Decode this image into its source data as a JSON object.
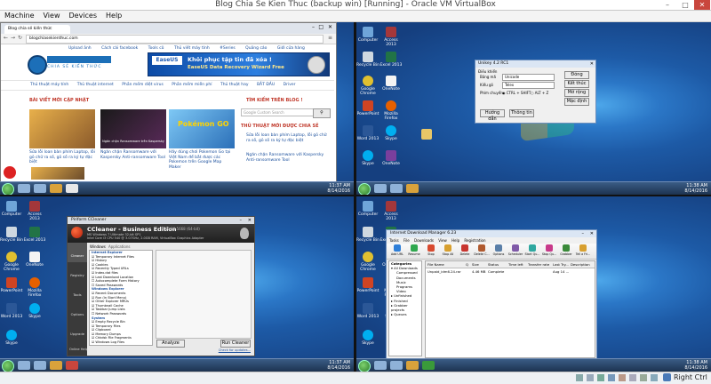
{
  "host": {
    "title": "Blog Chia Se Kien Thuc (backup win) [Running] - Oracle VM VirtualBox",
    "menu": [
      "Machine",
      "View",
      "Devices",
      "Help"
    ],
    "status_right": "Right Ctrl"
  },
  "desktop_icons": {
    "computer": "Computer",
    "access": "Access 2013",
    "recycle": "Recycle Bin",
    "excel": "Excel 2013",
    "chrome": "Google Chrome",
    "onenote": "OneNote",
    "skype": "Skype",
    "powerpoint": "PowerPoint",
    "firefox": "Mozilla Firefox",
    "word": "Word 2013"
  },
  "tray": {
    "q1": {
      "time": "11:37 AM",
      "date": "8/14/2016"
    },
    "q2": {
      "time": "11:38 AM",
      "date": "8/14/2016"
    },
    "q3": {
      "time": "11:37 AM",
      "date": "8/14/2016"
    },
    "q4": {
      "time": "11:38 AM",
      "date": "8/14/2016"
    }
  },
  "browser": {
    "tab": "Blog chia sẻ kiến thức",
    "url": "blogchiasekienthuc.com",
    "top_links": [
      "Upload ảnh",
      "Cách cài facebook",
      "Tools cũ",
      "Thủ viết máy tính",
      "#Series",
      "Quảng cáo",
      "Giới cửa hàng"
    ],
    "logo_text": "CHIA SẺ KIẾN THỨC",
    "ad_brand": "EaseUS",
    "ad_line1": "Khôi phục tập tin đã xóa !",
    "ad_line2": "EaseUS Data Recovery Wizard Free",
    "nav": [
      "Thủ thuật máy tính",
      "Thủ thuật internet",
      "Phần mềm diệt virus",
      "Phần mềm miễn phí",
      "Thủ thuật hay",
      "BẮT ĐẦU",
      "Driver"
    ],
    "section_new": "BÀI VIẾT MỚI CẬP NHẬT",
    "section_search": "TÌM KIẾM TRÊN BLOG !",
    "search_placeholder": "Google Custom Search",
    "section_share": "THỦ THUẬT MỚI ĐƯỢC CHIA SẺ",
    "thumb2_caption": "Ngăn chặn Ransomware trên Kaspersky",
    "thumb3_text": "Pokémon GO",
    "articles": [
      "Sửa lỗi loan bàn phím Laptop, lỗi gõ chữ ra số, gõ số ra ký tự đặc biệt",
      "Ngăn chặn Ransomware với Kaspersky Anti-ransomware Tool",
      "Hãy dùng chơi Pokemon Go tại Việt Nam để bắt được các Pokemon trên Google Map Maker"
    ],
    "share_items": [
      "Sửa lỗi loan bàn phím Laptop, lỗi gõ chữ ra số, gõ số ra ký tự đặc biệt",
      "Ngăn chặn Ransomware với Kaspersky Anti-ransomware Tool"
    ]
  },
  "unikey": {
    "title": "Unikey 4.2 RC1",
    "section_control": "Điều khiển",
    "labels": {
      "charset": "Bảng mã",
      "method": "Kiểu gõ",
      "switch": "Phím chuyển"
    },
    "charset": "Unicode",
    "method": "Telex",
    "radio1": "CTRL + SHIFT",
    "radio2": "ALT + Z",
    "buttons": {
      "close": "Đóng",
      "exit": "Kết thúc",
      "more": "Mở rộng",
      "default": "Mặc định",
      "help": "Hướng dẫn",
      "info": "Thông tin"
    }
  },
  "ccleaner": {
    "title": "Piriform CCleaner",
    "product": "CCleaner - Business Edition",
    "version": "v5.20.5668 (64-bit)",
    "sysinfo1": "MS Windows 7 Ultimate 32-bit SP1",
    "sysinfo2": "Intel Core i3 CPU 540 @ 3.07GHz, 2.0GB RAM, VirtualBox Graphics Adapter",
    "tabs": [
      "Windows",
      "Applications"
    ],
    "sidebar": [
      "Cleaner",
      "Registry",
      "Tools",
      "Options",
      "Upgrade"
    ],
    "groups": {
      "ie": "Internet Explorer",
      "explorer": "Windows Explorer",
      "system": "System"
    },
    "items_ie": [
      "Temporary Internet Files",
      "History",
      "Cookies",
      "Recently Typed URLs",
      "Index.dat files",
      "Last Download Location",
      "Autocomplete Form History",
      "Saved Passwords"
    ],
    "items_explorer": [
      "Recent Documents",
      "Run (in Start Menu)",
      "Other Explorer MRUs",
      "Thumbnail Cache",
      "Taskbar Jump Lists",
      "Network Passwords"
    ],
    "items_system": [
      "Empty Recycle Bin",
      "Temporary Files",
      "Clipboard",
      "Memory Dumps",
      "Chkdsk File Fragments",
      "Windows Log Files"
    ],
    "analyze": "Analyze",
    "run": "Run Cleaner",
    "online_help": "Online Help",
    "check_updates": "Check for updates..."
  },
  "idm": {
    "title": "Internet Download Manager 6.23",
    "menu": [
      "Tasks",
      "File",
      "Downloads",
      "View",
      "Help",
      "Registration"
    ],
    "toolbar": [
      "Add URL",
      "Resume",
      "Stop",
      "Stop All",
      "Delete",
      "Delete C...",
      "Options",
      "Scheduler",
      "Start Qu...",
      "Stop Qu...",
      "Grabber",
      "Tell a Fri..."
    ],
    "categories_header": "Categories",
    "categories": [
      "All Downloads",
      "Compressed",
      "Documents",
      "Music",
      "Programs",
      "Video",
      "Unfinished",
      "Finished",
      "Grabber projects",
      "Queues"
    ],
    "columns": [
      "File Name",
      "Q",
      "Size",
      "Status",
      "Time left",
      "Transfer rate",
      "Last Try...",
      "Description"
    ],
    "rows": [
      {
        "name": "Unpaid_idm6.24.rar",
        "size": "4.46 MB",
        "status": "Complete",
        "last": "Aug 14 ..."
      }
    ]
  }
}
